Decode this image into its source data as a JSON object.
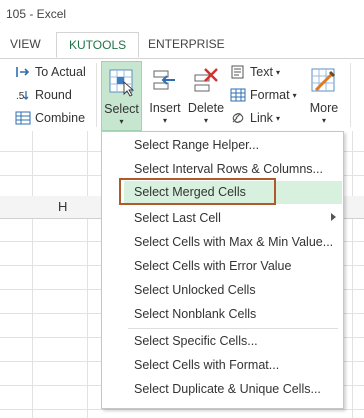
{
  "window": {
    "title": "105 - Excel"
  },
  "tabs": [
    {
      "label": "VIEW"
    },
    {
      "label": "KUTOOLS"
    },
    {
      "label": "ENTERPRISE"
    }
  ],
  "ribbon": {
    "small_buttons": [
      {
        "label": "To Actual",
        "icon": "to-actual-icon"
      },
      {
        "label": "Round",
        "icon": "round-icon"
      },
      {
        "label": "Combine",
        "icon": "combine-icon"
      }
    ],
    "big_buttons": {
      "select": "Select",
      "insert": "Insert",
      "delete": "Delete",
      "more": "More"
    },
    "dropdowns": {
      "text": "Text",
      "format": "Format",
      "link": "Link"
    },
    "caret": "▾"
  },
  "sheet": {
    "column_h": "H"
  },
  "menu": {
    "items": [
      {
        "label": "Select Range Helper..."
      },
      {
        "label": "Select Interval Rows & Columns..."
      },
      {
        "label": "Select Merged Cells",
        "highlighted": true
      },
      {
        "label": "Select Last Cell",
        "submenu": true
      },
      {
        "label": "Select Cells with Max & Min Value..."
      },
      {
        "label": "Select Cells with Error Value"
      },
      {
        "label": "Select Unlocked Cells"
      },
      {
        "label": "Select Nonblank Cells"
      },
      {
        "label": "Select Specific Cells..."
      },
      {
        "label": "Select Cells with Format..."
      },
      {
        "label": "Select Duplicate & Unique Cells..."
      }
    ]
  },
  "colors": {
    "accent_green": "#217346",
    "select_bg": "#c6e6d0",
    "menu_highlight": "#d8f0de",
    "highlight_border": "#b05a2c"
  }
}
